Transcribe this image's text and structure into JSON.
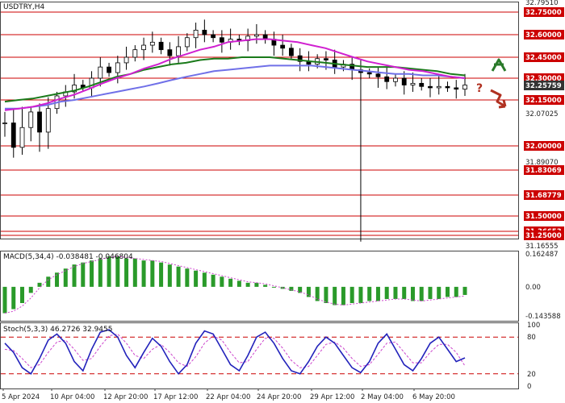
{
  "chart_data": {
    "type": "candlestick",
    "symbol_label": "USDTRY,H4",
    "main": {
      "ylim": [
        32.16555,
        32.7951
      ],
      "axis_ticks": [
        {
          "label": "32.79510",
          "value": 32.7951,
          "highlight": false
        },
        {
          "label": "32.75000",
          "value": 32.75,
          "highlight": true
        },
        {
          "label": "32.60000",
          "value": 32.6,
          "highlight": true
        },
        {
          "label": "32.45000",
          "value": 32.45,
          "highlight": true
        },
        {
          "label": "32.30000",
          "value": 32.3,
          "highlight": true
        },
        {
          "label": "32.25759",
          "value": 32.25759,
          "highlight": false,
          "current": true
        },
        {
          "label": "32.15000",
          "value": 32.15,
          "highlight": true
        },
        {
          "label": "32.07025",
          "value": 32.07025,
          "highlight": false
        },
        {
          "label": "32.00000",
          "value": 32.0,
          "highlight": true
        },
        {
          "label": "31.89070",
          "value": 31.8907,
          "highlight": false
        },
        {
          "label": "31.83069",
          "value": 31.83069,
          "highlight": true
        },
        {
          "label": "31.68779",
          "value": 31.68779,
          "highlight": true
        },
        {
          "label": "31.50000",
          "value": 31.5,
          "highlight": true
        },
        {
          "label": "31.36653",
          "value": 31.36653,
          "highlight": true
        },
        {
          "label": "31.25000",
          "value": 31.25,
          "highlight": true
        },
        {
          "label": "31.16555",
          "value": 31.16555,
          "highlight": false
        }
      ],
      "levels": [
        32.75,
        32.6,
        32.45,
        32.3,
        32.15,
        32.0,
        31.83069,
        31.68779,
        31.5,
        31.36653,
        31.25
      ],
      "ma_short": [
        32.09,
        32.1,
        32.11,
        32.13,
        32.16,
        32.19,
        32.23,
        32.27,
        32.3,
        32.33,
        32.37,
        32.4,
        32.44,
        32.47,
        32.5,
        32.52,
        32.55,
        32.56,
        32.57,
        32.57,
        32.56,
        32.55,
        32.53,
        32.51,
        32.48,
        32.45,
        32.42,
        32.4,
        32.38,
        32.36,
        32.35,
        32.33,
        32.31,
        32.3
      ],
      "ma_mid": [
        32.14,
        32.15,
        32.16,
        32.18,
        32.2,
        32.22,
        32.25,
        32.28,
        32.31,
        32.33,
        32.36,
        32.38,
        32.4,
        32.41,
        32.43,
        32.44,
        32.44,
        32.45,
        32.45,
        32.45,
        32.44,
        32.43,
        32.42,
        32.41,
        32.4,
        32.39,
        32.38,
        32.38,
        32.38,
        32.37,
        32.36,
        32.35,
        32.33,
        32.32
      ],
      "ma_long": [
        32.1,
        32.1,
        32.11,
        32.12,
        32.14,
        32.15,
        32.17,
        32.19,
        32.21,
        32.23,
        32.25,
        32.27,
        32.29,
        32.31,
        32.33,
        32.35,
        32.36,
        32.37,
        32.38,
        32.39,
        32.39,
        32.39,
        32.39,
        32.38,
        32.37,
        32.36,
        32.35,
        32.34,
        32.33,
        32.33,
        32.32,
        32.32,
        32.31,
        32.3
      ],
      "close_path": [
        32.05,
        31.99,
        32.04,
        32.08,
        32.03,
        32.1,
        32.18,
        32.21,
        32.26,
        32.24,
        32.3,
        32.38,
        32.34,
        32.41,
        32.45,
        32.5,
        32.53,
        32.55,
        32.5,
        32.46,
        32.52,
        32.58,
        32.63,
        32.6,
        32.58,
        32.55,
        32.57,
        32.56,
        32.59,
        32.6,
        32.57,
        32.53,
        32.51,
        32.46,
        32.42,
        32.4,
        32.44,
        32.43,
        32.38,
        32.4,
        32.36,
        32.34,
        32.33,
        32.31,
        32.28,
        32.3,
        32.26,
        32.27,
        32.25,
        32.24,
        32.25,
        32.24,
        32.23,
        32.26
      ]
    },
    "macd": {
      "label": "MACD(5,34,4) -0.038481 -0.046804",
      "ylim": [
        -0.143588,
        0.162487
      ],
      "axis_ticks": [
        {
          "label": "0.162487",
          "value": 0.162487
        },
        {
          "label": "0.00",
          "value": 0.0
        },
        {
          "label": "-0.143588",
          "value": -0.143588
        }
      ],
      "histogram": [
        -0.13,
        -0.11,
        -0.08,
        -0.03,
        0.02,
        0.05,
        0.07,
        0.09,
        0.11,
        0.12,
        0.13,
        0.14,
        0.15,
        0.15,
        0.14,
        0.14,
        0.13,
        0.13,
        0.12,
        0.11,
        0.1,
        0.09,
        0.08,
        0.07,
        0.06,
        0.05,
        0.04,
        0.03,
        0.02,
        0.02,
        0.01,
        0.0,
        -0.01,
        -0.02,
        -0.03,
        -0.05,
        -0.07,
        -0.08,
        -0.09,
        -0.09,
        -0.08,
        -0.08,
        -0.07,
        -0.07,
        -0.06,
        -0.06,
        -0.06,
        -0.07,
        -0.07,
        -0.06,
        -0.06,
        -0.05,
        -0.05,
        -0.04
      ]
    },
    "stoch": {
      "label": "Stoch(5,3,3) 46.2726 32.9455",
      "ylim": [
        0,
        100
      ],
      "axis_ticks": [
        {
          "label": "100",
          "value": 100
        },
        {
          "label": "80",
          "value": 80
        },
        {
          "label": "20",
          "value": 20
        },
        {
          "label": "0",
          "value": 0
        }
      ],
      "levels": [
        80,
        20
      ],
      "k": [
        70,
        55,
        30,
        20,
        45,
        75,
        85,
        70,
        40,
        25,
        60,
        88,
        92,
        80,
        50,
        30,
        55,
        78,
        65,
        40,
        20,
        35,
        70,
        90,
        85,
        60,
        35,
        25,
        50,
        80,
        88,
        70,
        45,
        25,
        20,
        40,
        65,
        80,
        70,
        50,
        30,
        22,
        40,
        70,
        85,
        60,
        35,
        25,
        45,
        70,
        80,
        60,
        40,
        46
      ],
      "d": [
        60,
        58,
        45,
        30,
        35,
        55,
        72,
        75,
        60,
        42,
        45,
        65,
        82,
        85,
        70,
        50,
        45,
        60,
        68,
        55,
        38,
        32,
        48,
        70,
        82,
        75,
        55,
        38,
        40,
        60,
        78,
        78,
        62,
        42,
        30,
        32,
        50,
        68,
        72,
        62,
        45,
        32,
        35,
        52,
        70,
        72,
        55,
        38,
        38,
        55,
        68,
        68,
        55,
        33
      ]
    },
    "x_labels": [
      "5 Apr 2024",
      "10 Apr 04:00",
      "12 Apr 20:00",
      "17 Apr 12:00",
      "22 Apr 04:00",
      "24 Apr 20:00",
      "29 Apr 12:00",
      "2 May 04:00",
      "6 May 20:00"
    ],
    "colors": {
      "bull": "#000000",
      "bear": "#000000",
      "ma_short": "#d020d0",
      "ma_mid": "#1a7a1a",
      "ma_long": "#7070e8",
      "level": "#cc0000",
      "tick_bg": "#cc0000",
      "current_bg": "#333333",
      "macd_bar": "#2a9a2a",
      "macd_signal": "#cc44cc",
      "stoch_k": "#2222bb",
      "stoch_d": "#cc44cc",
      "arrow_up": "#2a7a2a",
      "arrow_down": "#b03020"
    },
    "scenario_mark": "?"
  }
}
